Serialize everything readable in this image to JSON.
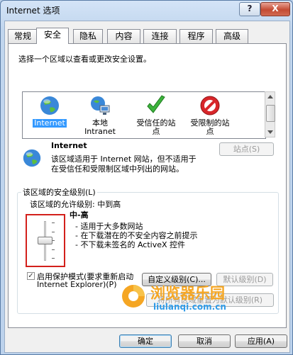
{
  "window": {
    "title": "Internet 选项",
    "help_label": "?",
    "close_label": "X"
  },
  "tabs": [
    "常规",
    "安全",
    "隐私",
    "内容",
    "连接",
    "程序",
    "高级"
  ],
  "active_tab": "安全",
  "security": {
    "instruction": "选择一个区域以查看或更改安全设置。",
    "zones": [
      {
        "label": "Internet",
        "icon": "globe-icon"
      },
      {
        "label": "本地\nIntranet",
        "icon": "intranet-icon"
      },
      {
        "label": "受信任的站\n点",
        "icon": "check-icon"
      },
      {
        "label": "受限制的站\n点",
        "icon": "no-entry-icon"
      }
    ],
    "selected_zone": "Internet",
    "zone_title": "Internet",
    "zone_desc_1": "该区域适用于 Internet 网站，但不适用于",
    "zone_desc_2": "在受信任和受限制区域中列出的网站。",
    "sites_button": "站点(S)",
    "level_group_title": "该区域的安全级别(L)",
    "allowed_levels": "该区域的允许级别: 中到高",
    "level_name": "中-高",
    "level_bullets": [
      "- 适用于大多数网站",
      "- 在下载潜在的不安全内容之前提示",
      "- 不下载未签名的 ActiveX 控件"
    ],
    "slider_level_index": 2,
    "slider_level_count": 5,
    "protected_mode_checked": true,
    "protected_mode_label_1": "启用保护模式(要求重新启动",
    "protected_mode_label_2": "Internet Explorer)(P)",
    "custom_level_button": "自定义级别(C)...",
    "default_level_button": "默认级别(D)",
    "reset_all_button": "将所有区域重置为默认级别(R)"
  },
  "footer": {
    "ok": "确定",
    "cancel": "取消",
    "apply": "应用(A)"
  },
  "watermark": {
    "title": "浏览器乐园",
    "url": "liulanqi.com.cn"
  },
  "colors": {
    "accent": "#3399ff",
    "highlight_box": "#d3201b",
    "watermark_orange": "#f5a623",
    "watermark_blue": "#2f9be8"
  }
}
